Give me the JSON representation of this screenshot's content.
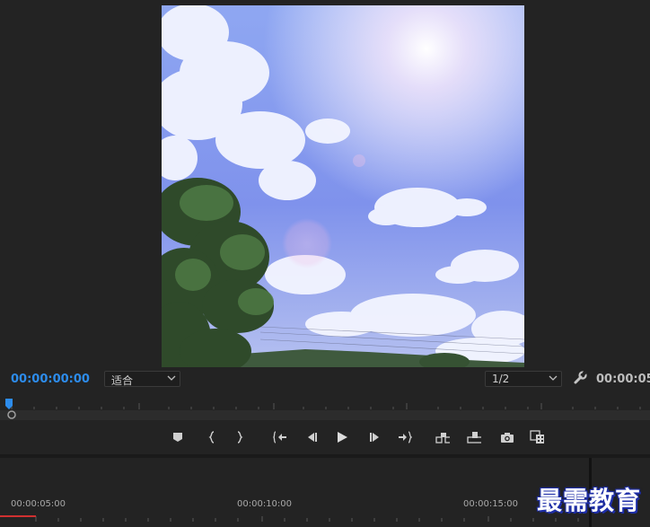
{
  "monitor": {
    "current_timecode": "00:00:00:00",
    "duration_timecode": "00:00:05:",
    "zoom_select": "适合",
    "resolution_select": "1/2",
    "accent_color": "#2d8ceb"
  },
  "transport": {
    "buttons": [
      {
        "name": "add-marker",
        "icon": "marker-icon"
      },
      {
        "name": "mark-in",
        "icon": "mark-in-icon"
      },
      {
        "name": "mark-out",
        "icon": "mark-out-icon"
      },
      {
        "name": "go-to-in",
        "icon": "go-to-in-icon"
      },
      {
        "name": "step-back",
        "icon": "step-back-icon"
      },
      {
        "name": "play",
        "icon": "play-icon"
      },
      {
        "name": "step-forward",
        "icon": "step-forward-icon"
      },
      {
        "name": "go-to-out",
        "icon": "go-to-out-icon"
      },
      {
        "name": "insert",
        "icon": "insert-icon"
      },
      {
        "name": "overwrite",
        "icon": "overwrite-icon"
      },
      {
        "name": "export-frame",
        "icon": "camera-icon"
      },
      {
        "name": "comparison-view",
        "icon": "compare-icon"
      }
    ]
  },
  "timeline": {
    "times": [
      "00:00:05:00",
      "00:00:10:00",
      "00:00:15:00"
    ]
  },
  "watermark": "最需教育"
}
